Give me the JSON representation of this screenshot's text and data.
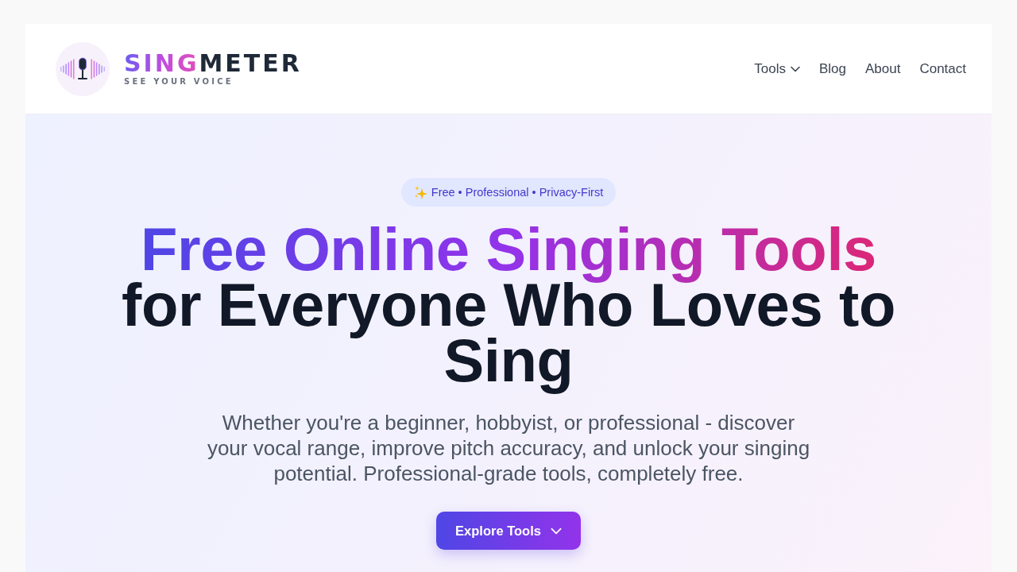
{
  "header": {
    "logo": {
      "name_highlight": "SING",
      "name_rest": "METER",
      "tagline": "SEE YOUR VOICE"
    },
    "nav": [
      {
        "label": "Tools",
        "kind": "dropdown"
      },
      {
        "label": "Blog",
        "kind": "link"
      },
      {
        "label": "About",
        "kind": "link"
      },
      {
        "label": "Contact",
        "kind": "link"
      }
    ]
  },
  "hero": {
    "badge": "Free • Professional • Privacy-First",
    "heading": {
      "highlight": "Free Online Singing Tools",
      "rest": "for Everyone Who Loves to Sing"
    },
    "subtitle": "Whether you're a beginner, hobbyist, or professional - discover your vocal range, improve pitch accuracy, and unlock your singing potential. Professional-grade tools, completely free.",
    "cta": {
      "label": "Explore Tools"
    }
  }
}
